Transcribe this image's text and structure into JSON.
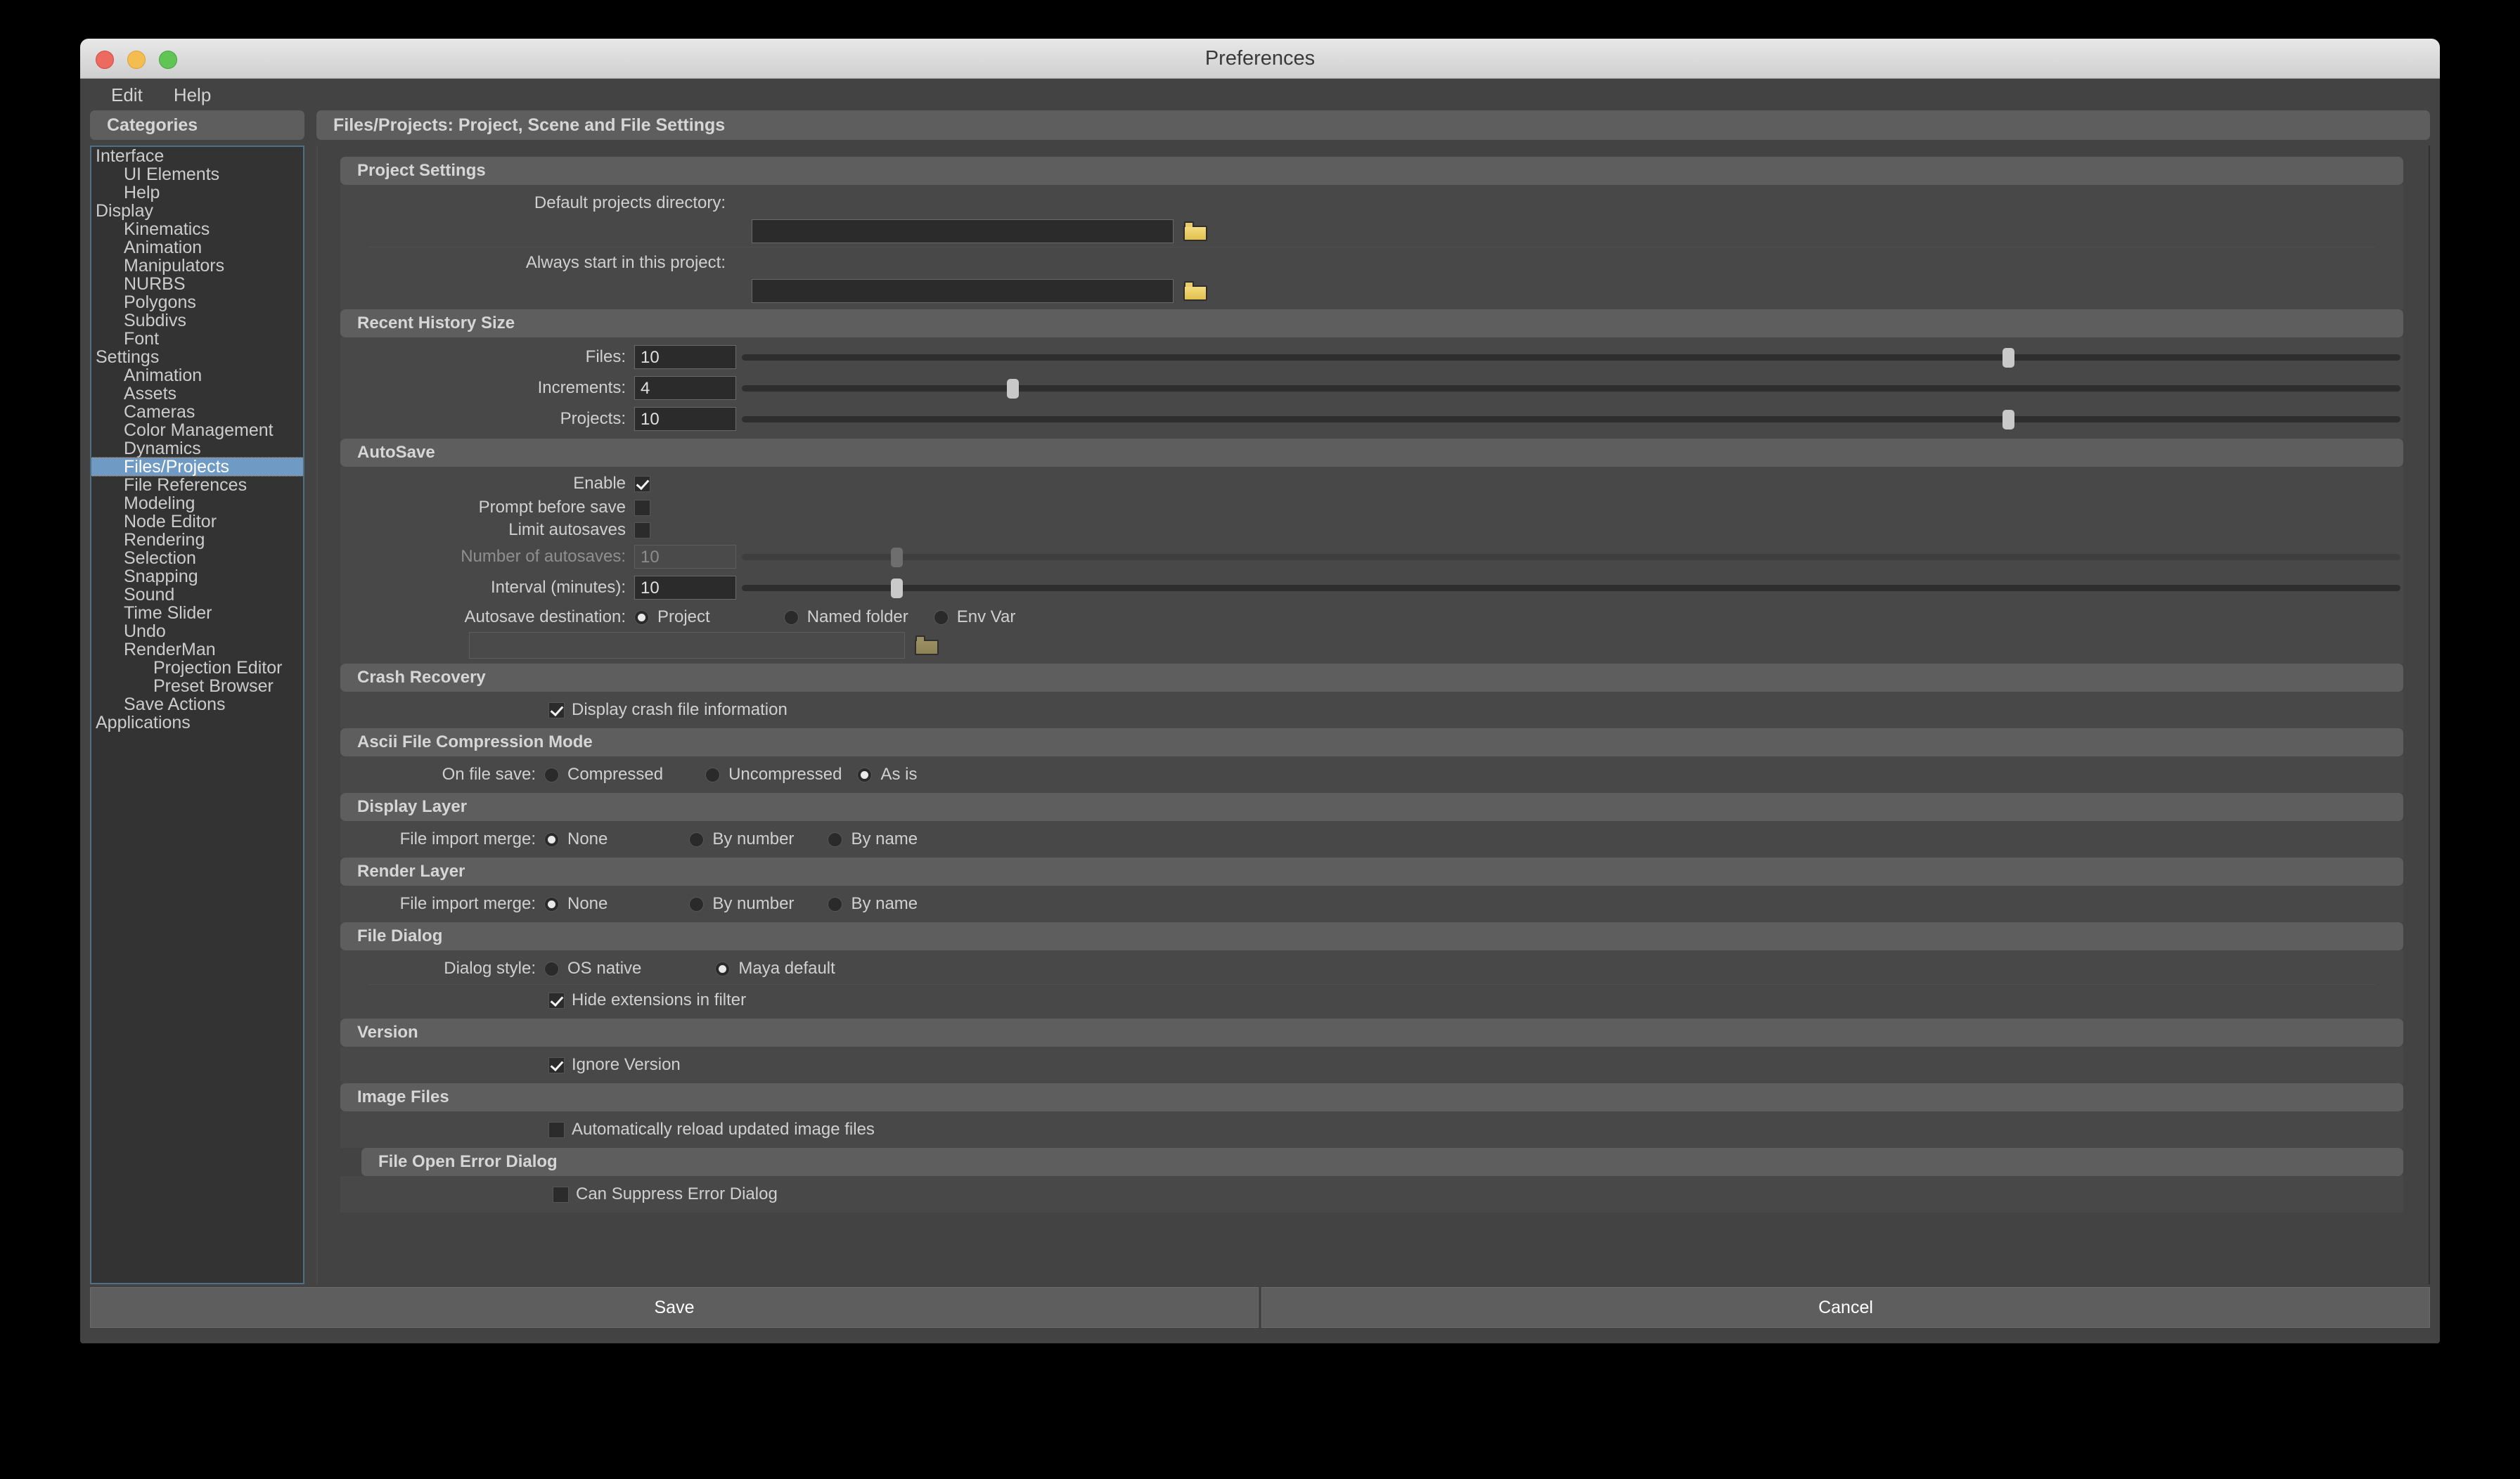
{
  "window": {
    "title": "Preferences"
  },
  "menubar": {
    "items": [
      "Edit",
      "Help"
    ]
  },
  "sidebar": {
    "header": "Categories",
    "items": [
      {
        "label": "Interface",
        "level": 0,
        "selected": false
      },
      {
        "label": "UI Elements",
        "level": 1,
        "selected": false
      },
      {
        "label": "Help",
        "level": 1,
        "selected": false
      },
      {
        "label": "Display",
        "level": 0,
        "selected": false
      },
      {
        "label": "Kinematics",
        "level": 1,
        "selected": false
      },
      {
        "label": "Animation",
        "level": 1,
        "selected": false
      },
      {
        "label": "Manipulators",
        "level": 1,
        "selected": false
      },
      {
        "label": "NURBS",
        "level": 1,
        "selected": false
      },
      {
        "label": "Polygons",
        "level": 1,
        "selected": false
      },
      {
        "label": "Subdivs",
        "level": 1,
        "selected": false
      },
      {
        "label": "Font",
        "level": 1,
        "selected": false
      },
      {
        "label": "Settings",
        "level": 0,
        "selected": false
      },
      {
        "label": "Animation",
        "level": 1,
        "selected": false
      },
      {
        "label": "Assets",
        "level": 1,
        "selected": false
      },
      {
        "label": "Cameras",
        "level": 1,
        "selected": false
      },
      {
        "label": "Color Management",
        "level": 1,
        "selected": false
      },
      {
        "label": "Dynamics",
        "level": 1,
        "selected": false
      },
      {
        "label": "Files/Projects",
        "level": 1,
        "selected": true
      },
      {
        "label": "File References",
        "level": 1,
        "selected": false
      },
      {
        "label": "Modeling",
        "level": 1,
        "selected": false
      },
      {
        "label": "Node Editor",
        "level": 1,
        "selected": false
      },
      {
        "label": "Rendering",
        "level": 1,
        "selected": false
      },
      {
        "label": "Selection",
        "level": 1,
        "selected": false
      },
      {
        "label": "Snapping",
        "level": 1,
        "selected": false
      },
      {
        "label": "Sound",
        "level": 1,
        "selected": false
      },
      {
        "label": "Time Slider",
        "level": 1,
        "selected": false
      },
      {
        "label": "Undo",
        "level": 1,
        "selected": false
      },
      {
        "label": "RenderMan",
        "level": 1,
        "selected": false
      },
      {
        "label": "Projection Editor",
        "level": 2,
        "selected": false
      },
      {
        "label": "Preset Browser",
        "level": 2,
        "selected": false
      },
      {
        "label": "Save Actions",
        "level": 1,
        "selected": false
      },
      {
        "label": "Applications",
        "level": 0,
        "selected": false
      }
    ]
  },
  "main": {
    "header": "Files/Projects: Project, Scene and File Settings",
    "project_settings": {
      "title": "Project Settings",
      "default_dir_label": "Default projects directory:",
      "default_dir_value": "",
      "always_start_label": "Always start in this project:",
      "always_start_value": "",
      "browse_icon": "folder-icon"
    },
    "recent_history": {
      "title": "Recent History Size",
      "rows": [
        {
          "label": "Files:",
          "value": "10",
          "knob_pct": 76
        },
        {
          "label": "Increments:",
          "value": "4",
          "knob_pct": 16
        },
        {
          "label": "Projects:",
          "value": "10",
          "knob_pct": 76
        }
      ]
    },
    "autosave": {
      "title": "AutoSave",
      "enable_label": "Enable",
      "enable_checked": true,
      "prompt_label": "Prompt before save",
      "prompt_checked": false,
      "limit_label": "Limit autosaves",
      "limit_checked": false,
      "num_label": "Number of autosaves:",
      "num_value": "10",
      "num_knob_pct": 9,
      "interval_label": "Interval (minutes):",
      "interval_value": "10",
      "interval_knob_pct": 9,
      "destination_label": "Autosave destination:",
      "destination_options": [
        "Project",
        "Named folder",
        "Env Var"
      ],
      "destination_selected": "Project",
      "destination_path": "",
      "browse_icon": "folder-icon"
    },
    "crash_recovery": {
      "title": "Crash Recovery",
      "display_crash_label": "Display crash file information",
      "display_crash_checked": true
    },
    "ascii_compression": {
      "title": "Ascii File Compression Mode",
      "label": "On file save:",
      "options": [
        "Compressed",
        "Uncompressed",
        "As is"
      ],
      "selected": "As is"
    },
    "display_layer": {
      "title": "Display Layer",
      "label": "File import merge:",
      "options": [
        "None",
        "By number",
        "By name"
      ],
      "selected": "None"
    },
    "render_layer": {
      "title": "Render Layer",
      "label": "File import merge:",
      "options": [
        "None",
        "By number",
        "By name"
      ],
      "selected": "None"
    },
    "file_dialog": {
      "title": "File Dialog",
      "style_label": "Dialog style:",
      "style_options": [
        "OS native",
        "Maya default"
      ],
      "style_selected": "Maya default",
      "hide_ext_label": "Hide extensions in filter",
      "hide_ext_checked": true
    },
    "version": {
      "title": "Version",
      "ignore_label": "Ignore Version",
      "ignore_checked": true
    },
    "image_files": {
      "title": "Image Files",
      "auto_reload_label": "Automatically reload updated image files",
      "auto_reload_checked": false
    },
    "file_open_error": {
      "title": "File Open Error Dialog",
      "suppress_label": "Can Suppress Error Dialog",
      "suppress_checked": false
    }
  },
  "footer": {
    "save_label": "Save",
    "cancel_label": "Cancel"
  }
}
